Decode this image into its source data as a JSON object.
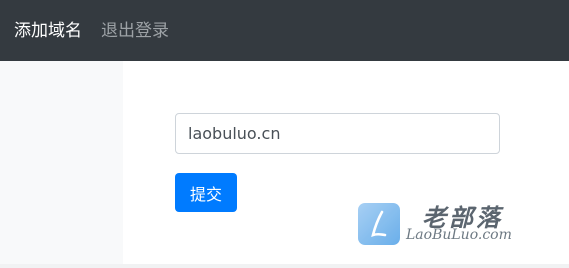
{
  "navbar": {
    "brand": "添加域名",
    "logout": "退出登录"
  },
  "form": {
    "domain_value": "laobuluo.cn",
    "submit_label": "提交"
  },
  "watermark": {
    "chinese": "老部落",
    "english": "LaoBuLuo.com"
  },
  "colors": {
    "navbar_bg": "#343a40",
    "primary": "#007bff",
    "sidebar_bg": "#f8f9fa"
  }
}
